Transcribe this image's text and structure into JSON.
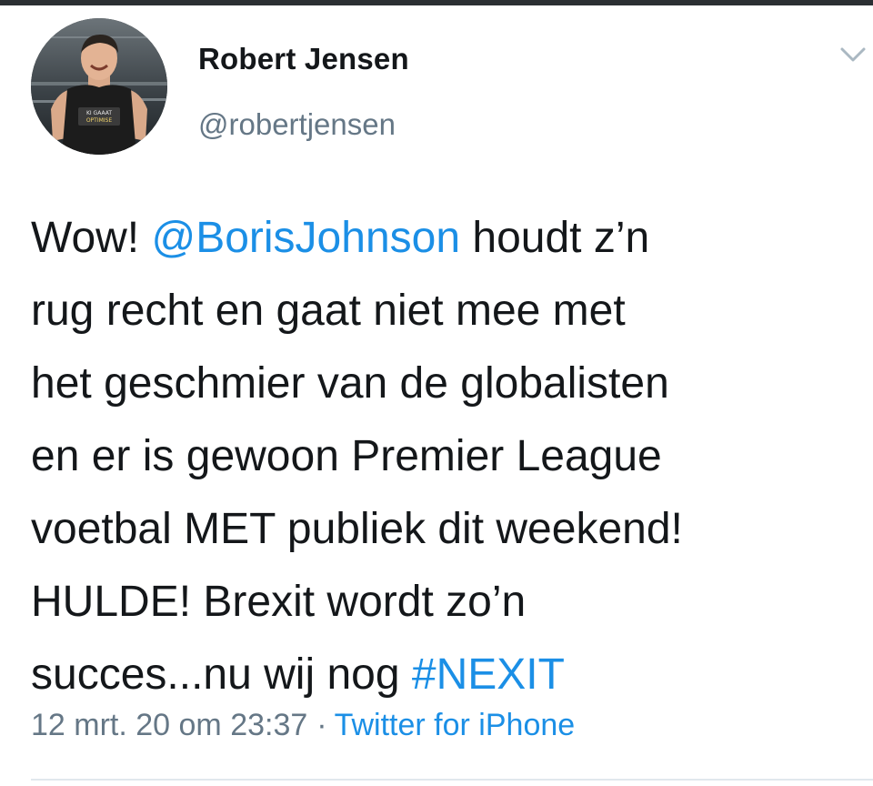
{
  "user": {
    "display_name": "Robert Jensen",
    "handle": "@robertjensen",
    "avatar_icon": "profile-photo",
    "shirt_text_line1": "KI GAAAT",
    "shirt_text_line2": "OPTIMISE"
  },
  "menu": {
    "icon": "chevron-down-icon"
  },
  "tweet": {
    "lines": [
      [
        "Wow! ",
        "@BorisJohnson",
        " houdt z’n"
      ],
      "rug recht en gaat niet mee met",
      "het geschmier van de globalisten",
      "en er is gewoon Premier League",
      "voetbal MET publiek dit weekend!",
      "HULDE! Brexit wordt zo’n",
      [
        "succes...nu wij nog ",
        "#NEXIT"
      ]
    ],
    "line1_prefix": "Wow! ",
    "mention": "@BorisJohnson",
    "line1_suffix": " houdt z’n",
    "line2": "rug recht en gaat niet mee met",
    "line3": "het geschmier van de globalisten",
    "line4": "en er is gewoon Premier League",
    "line5": "voetbal MET publiek dit weekend!",
    "line6": "HULDE! Brexit wordt zo’n",
    "line7_prefix": "succes...nu wij nog ",
    "hashtag": "#NEXIT"
  },
  "meta": {
    "timestamp": "12 mrt. 20 om 23:37",
    "separator": "·",
    "source": "Twitter for iPhone"
  },
  "colors": {
    "link": "#1b8fe6",
    "secondary": "#657786",
    "text": "#14171a",
    "divider": "#e1e8ed"
  }
}
